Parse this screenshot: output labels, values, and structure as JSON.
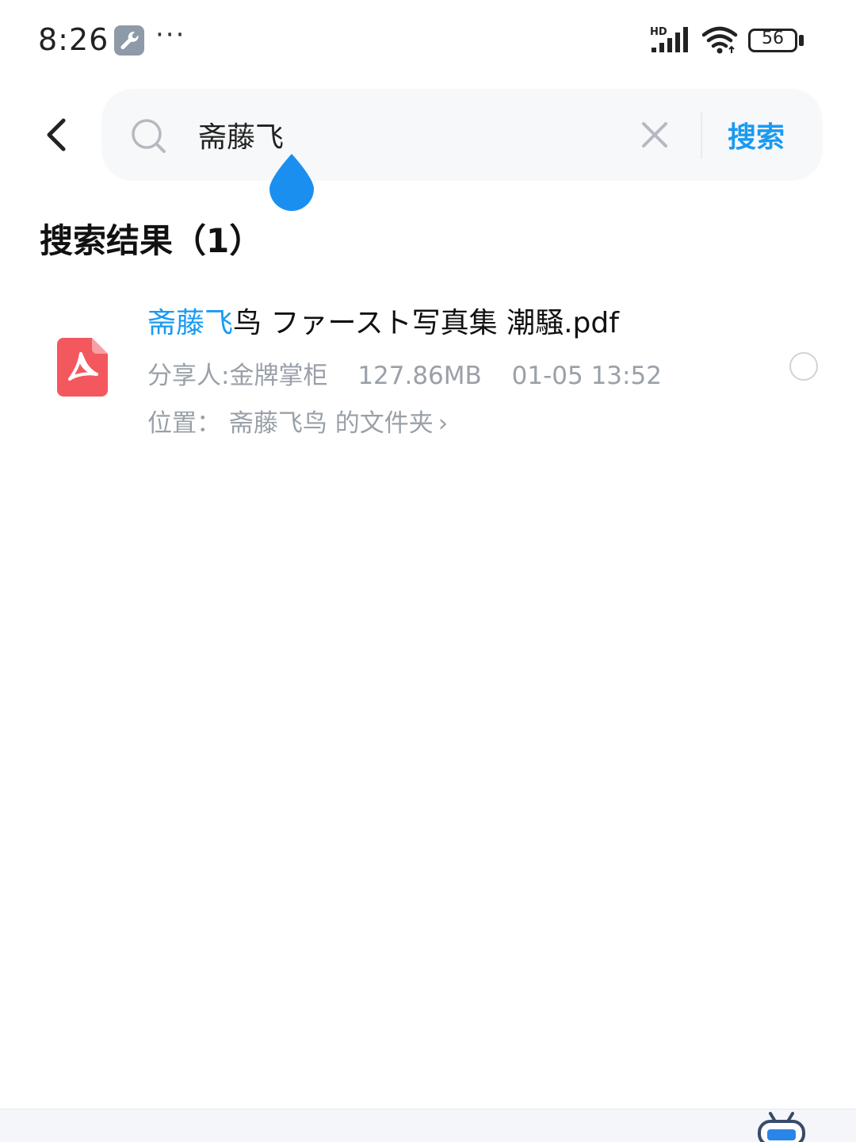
{
  "status_bar": {
    "time": "8:26",
    "more": "···",
    "network_label": "HD",
    "battery_level": "56",
    "icons": [
      "wrench-icon",
      "more-dots-icon",
      "signal-icon",
      "wifi-icon",
      "battery-icon"
    ]
  },
  "search": {
    "query": "斋藤飞",
    "placeholder": "",
    "submit_label": "搜索",
    "accent_color": "#1a9af2"
  },
  "results": {
    "title": "搜索结果（1）",
    "items": [
      {
        "name_highlight": "斋藤飞",
        "name_rest": "鸟 ファースト写真集 潮騒.pdf",
        "sharer": "分享人:金牌掌柜",
        "size": "127.86MB",
        "date": "01-05 13:52",
        "location": "位置： 斋藤飞鸟 的文件夹",
        "location_chevron": "›",
        "file_type_icon": "pdf-icon",
        "selected": false
      }
    ]
  }
}
